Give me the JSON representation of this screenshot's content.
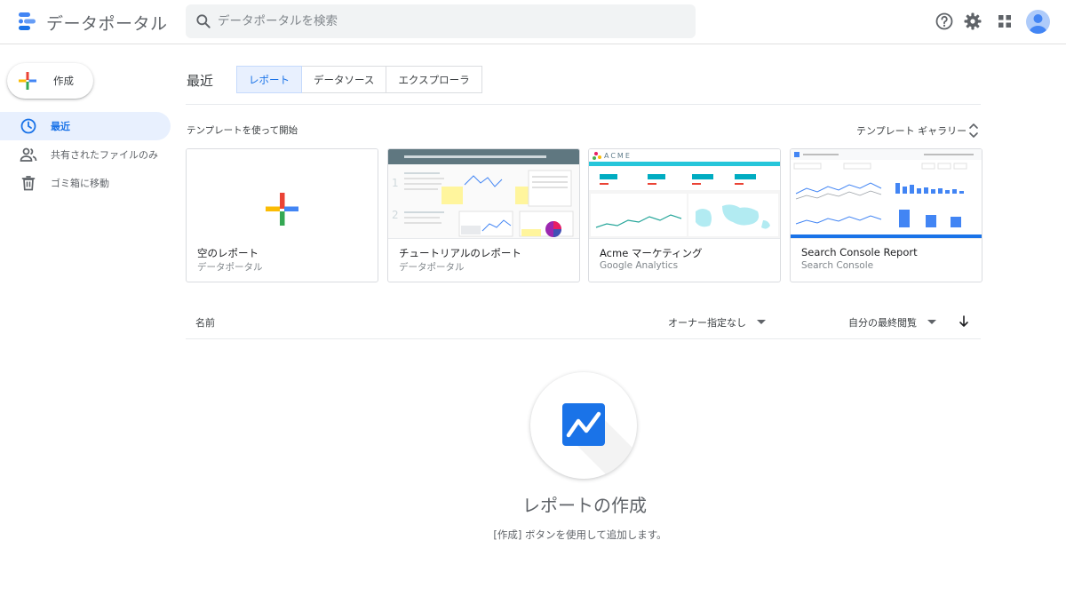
{
  "header": {
    "app_title": "データポータル",
    "search_placeholder": "データポータルを検索",
    "icons": [
      "help-icon",
      "settings-icon",
      "apps-icon",
      "account-avatar"
    ]
  },
  "sidebar": {
    "create_label": "作成",
    "items": [
      {
        "label": "最近",
        "icon": "clock-icon",
        "active": true
      },
      {
        "label": "共有されたファイルのみ",
        "icon": "people-icon",
        "active": false
      },
      {
        "label": "ゴミ箱に移動",
        "icon": "trash-icon",
        "active": false
      }
    ]
  },
  "main": {
    "section_title": "最近",
    "tabs": [
      {
        "label": "レポート",
        "active": true
      },
      {
        "label": "データソース",
        "active": false
      },
      {
        "label": "エクスプローラ",
        "active": false
      }
    ],
    "templates_heading": "テンプレートを使って開始",
    "gallery_label": "テンプレート ギャラリー",
    "templates": [
      {
        "title": "空のレポート",
        "subtitle": "データポータル"
      },
      {
        "title": "チュートリアルのレポート",
        "subtitle": "データポータル"
      },
      {
        "title": "Acme マーケティング",
        "subtitle": "Google Analytics"
      },
      {
        "title": "Search Console Report",
        "subtitle": "Search Console"
      }
    ],
    "list_header": {
      "name_label": "名前",
      "owner_filter": "オーナー指定なし",
      "sort_label": "自分の最終閲覧"
    },
    "empty_state": {
      "title": "レポートの作成",
      "subtitle": "[作成] ボタンを使用して追加します。"
    }
  },
  "colors": {
    "accent": "#1a73e8",
    "active_bg": "#e8f0fe",
    "google_blue": "#4285f4",
    "google_red": "#ea4335",
    "google_yellow": "#fbbc04",
    "google_green": "#34a853"
  }
}
